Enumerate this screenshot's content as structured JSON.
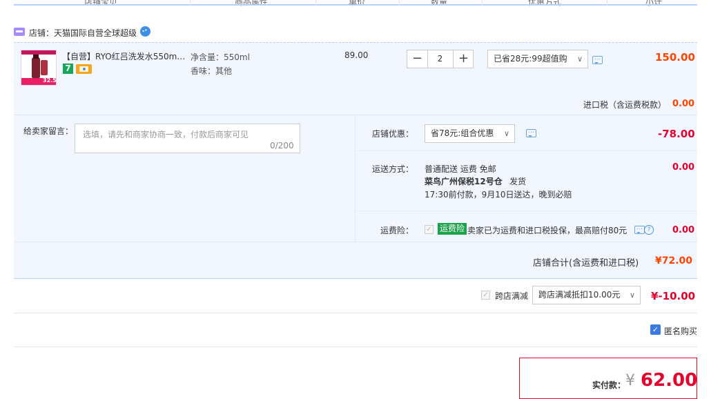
{
  "header": {
    "columns": [
      "店铺宝贝",
      "商品属性",
      "单价",
      "数量",
      "优惠方式",
      "小计"
    ]
  },
  "shop": {
    "label": "店铺：天猫国际自营全球超级"
  },
  "item": {
    "title": "【自营】RYO红吕洗发水550m…",
    "thumb_price": "32.5",
    "badge_7": "7",
    "attr_volume": "净含量：550ml",
    "attr_scent": "香味：其他",
    "unit_price": "89.00",
    "quantity": "2",
    "discount_option": "已省28元:99超值购",
    "subtotal": "150.00"
  },
  "tax": {
    "label": "进口税（含运费税款）",
    "value": "0.00"
  },
  "message": {
    "label": "给卖家留言：",
    "placeholder": "选填，请先和商家协商一致，付款后商家可见",
    "counter": "0/200"
  },
  "shop_discount": {
    "label": "店铺优惠：",
    "option": "省78元:组合优惠",
    "value": "-78.00"
  },
  "shipping": {
    "label": "运送方式：",
    "line1": "普通配送 运费 免邮",
    "warehouse": "菜鸟广州保税12号仓",
    "ship_word": "发货",
    "line3": "17:30前付款，9月10日送达，晚到必赔",
    "value": "0.00"
  },
  "insurance": {
    "label": "运费险：",
    "badge": "运费险",
    "text": "卖家已为运费和进口税投保，最高赔付80元",
    "value": "0.00"
  },
  "shop_total": {
    "label": "店铺合计(含运费和进口税)",
    "value": "¥72.00"
  },
  "cross_store": {
    "label": "跨店满减",
    "option": "跨店满减抵扣10.00元",
    "value": "¥-10.00"
  },
  "anonymous": {
    "label": "匿名购买",
    "checked": true
  },
  "payment": {
    "label": "实付款：",
    "currency": "¥",
    "value": "62.00"
  },
  "colors": {
    "accent_orange": "#ff4400",
    "price_red": "#e4002b",
    "panel_bg": "#f2f7ff",
    "border_blue": "#b2d1ff"
  }
}
